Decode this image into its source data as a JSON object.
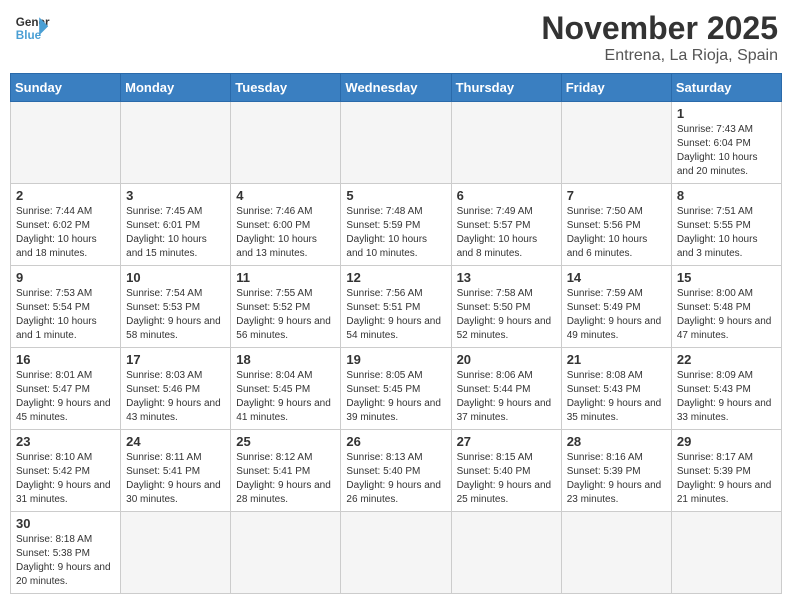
{
  "logo": {
    "line1": "General",
    "line2": "Blue"
  },
  "title": "November 2025",
  "location": "Entrena, La Rioja, Spain",
  "weekdays": [
    "Sunday",
    "Monday",
    "Tuesday",
    "Wednesday",
    "Thursday",
    "Friday",
    "Saturday"
  ],
  "days": [
    {
      "date": "",
      "info": ""
    },
    {
      "date": "",
      "info": ""
    },
    {
      "date": "",
      "info": ""
    },
    {
      "date": "",
      "info": ""
    },
    {
      "date": "",
      "info": ""
    },
    {
      "date": "",
      "info": ""
    },
    {
      "date": "1",
      "info": "Sunrise: 7:43 AM\nSunset: 6:04 PM\nDaylight: 10 hours\nand 20 minutes."
    },
    {
      "date": "2",
      "info": "Sunrise: 7:44 AM\nSunset: 6:02 PM\nDaylight: 10 hours\nand 18 minutes."
    },
    {
      "date": "3",
      "info": "Sunrise: 7:45 AM\nSunset: 6:01 PM\nDaylight: 10 hours\nand 15 minutes."
    },
    {
      "date": "4",
      "info": "Sunrise: 7:46 AM\nSunset: 6:00 PM\nDaylight: 10 hours\nand 13 minutes."
    },
    {
      "date": "5",
      "info": "Sunrise: 7:48 AM\nSunset: 5:59 PM\nDaylight: 10 hours\nand 10 minutes."
    },
    {
      "date": "6",
      "info": "Sunrise: 7:49 AM\nSunset: 5:57 PM\nDaylight: 10 hours\nand 8 minutes."
    },
    {
      "date": "7",
      "info": "Sunrise: 7:50 AM\nSunset: 5:56 PM\nDaylight: 10 hours\nand 6 minutes."
    },
    {
      "date": "8",
      "info": "Sunrise: 7:51 AM\nSunset: 5:55 PM\nDaylight: 10 hours\nand 3 minutes."
    },
    {
      "date": "9",
      "info": "Sunrise: 7:53 AM\nSunset: 5:54 PM\nDaylight: 10 hours\nand 1 minute."
    },
    {
      "date": "10",
      "info": "Sunrise: 7:54 AM\nSunset: 5:53 PM\nDaylight: 9 hours\nand 58 minutes."
    },
    {
      "date": "11",
      "info": "Sunrise: 7:55 AM\nSunset: 5:52 PM\nDaylight: 9 hours\nand 56 minutes."
    },
    {
      "date": "12",
      "info": "Sunrise: 7:56 AM\nSunset: 5:51 PM\nDaylight: 9 hours\nand 54 minutes."
    },
    {
      "date": "13",
      "info": "Sunrise: 7:58 AM\nSunset: 5:50 PM\nDaylight: 9 hours\nand 52 minutes."
    },
    {
      "date": "14",
      "info": "Sunrise: 7:59 AM\nSunset: 5:49 PM\nDaylight: 9 hours\nand 49 minutes."
    },
    {
      "date": "15",
      "info": "Sunrise: 8:00 AM\nSunset: 5:48 PM\nDaylight: 9 hours\nand 47 minutes."
    },
    {
      "date": "16",
      "info": "Sunrise: 8:01 AM\nSunset: 5:47 PM\nDaylight: 9 hours\nand 45 minutes."
    },
    {
      "date": "17",
      "info": "Sunrise: 8:03 AM\nSunset: 5:46 PM\nDaylight: 9 hours\nand 43 minutes."
    },
    {
      "date": "18",
      "info": "Sunrise: 8:04 AM\nSunset: 5:45 PM\nDaylight: 9 hours\nand 41 minutes."
    },
    {
      "date": "19",
      "info": "Sunrise: 8:05 AM\nSunset: 5:45 PM\nDaylight: 9 hours\nand 39 minutes."
    },
    {
      "date": "20",
      "info": "Sunrise: 8:06 AM\nSunset: 5:44 PM\nDaylight: 9 hours\nand 37 minutes."
    },
    {
      "date": "21",
      "info": "Sunrise: 8:08 AM\nSunset: 5:43 PM\nDaylight: 9 hours\nand 35 minutes."
    },
    {
      "date": "22",
      "info": "Sunrise: 8:09 AM\nSunset: 5:43 PM\nDaylight: 9 hours\nand 33 minutes."
    },
    {
      "date": "23",
      "info": "Sunrise: 8:10 AM\nSunset: 5:42 PM\nDaylight: 9 hours\nand 31 minutes."
    },
    {
      "date": "24",
      "info": "Sunrise: 8:11 AM\nSunset: 5:41 PM\nDaylight: 9 hours\nand 30 minutes."
    },
    {
      "date": "25",
      "info": "Sunrise: 8:12 AM\nSunset: 5:41 PM\nDaylight: 9 hours\nand 28 minutes."
    },
    {
      "date": "26",
      "info": "Sunrise: 8:13 AM\nSunset: 5:40 PM\nDaylight: 9 hours\nand 26 minutes."
    },
    {
      "date": "27",
      "info": "Sunrise: 8:15 AM\nSunset: 5:40 PM\nDaylight: 9 hours\nand 25 minutes."
    },
    {
      "date": "28",
      "info": "Sunrise: 8:16 AM\nSunset: 5:39 PM\nDaylight: 9 hours\nand 23 minutes."
    },
    {
      "date": "29",
      "info": "Sunrise: 8:17 AM\nSunset: 5:39 PM\nDaylight: 9 hours\nand 21 minutes."
    },
    {
      "date": "30",
      "info": "Sunrise: 8:18 AM\nSunset: 5:38 PM\nDaylight: 9 hours\nand 20 minutes."
    },
    {
      "date": "",
      "info": ""
    },
    {
      "date": "",
      "info": ""
    },
    {
      "date": "",
      "info": ""
    },
    {
      "date": "",
      "info": ""
    },
    {
      "date": "",
      "info": ""
    },
    {
      "date": "",
      "info": ""
    }
  ]
}
